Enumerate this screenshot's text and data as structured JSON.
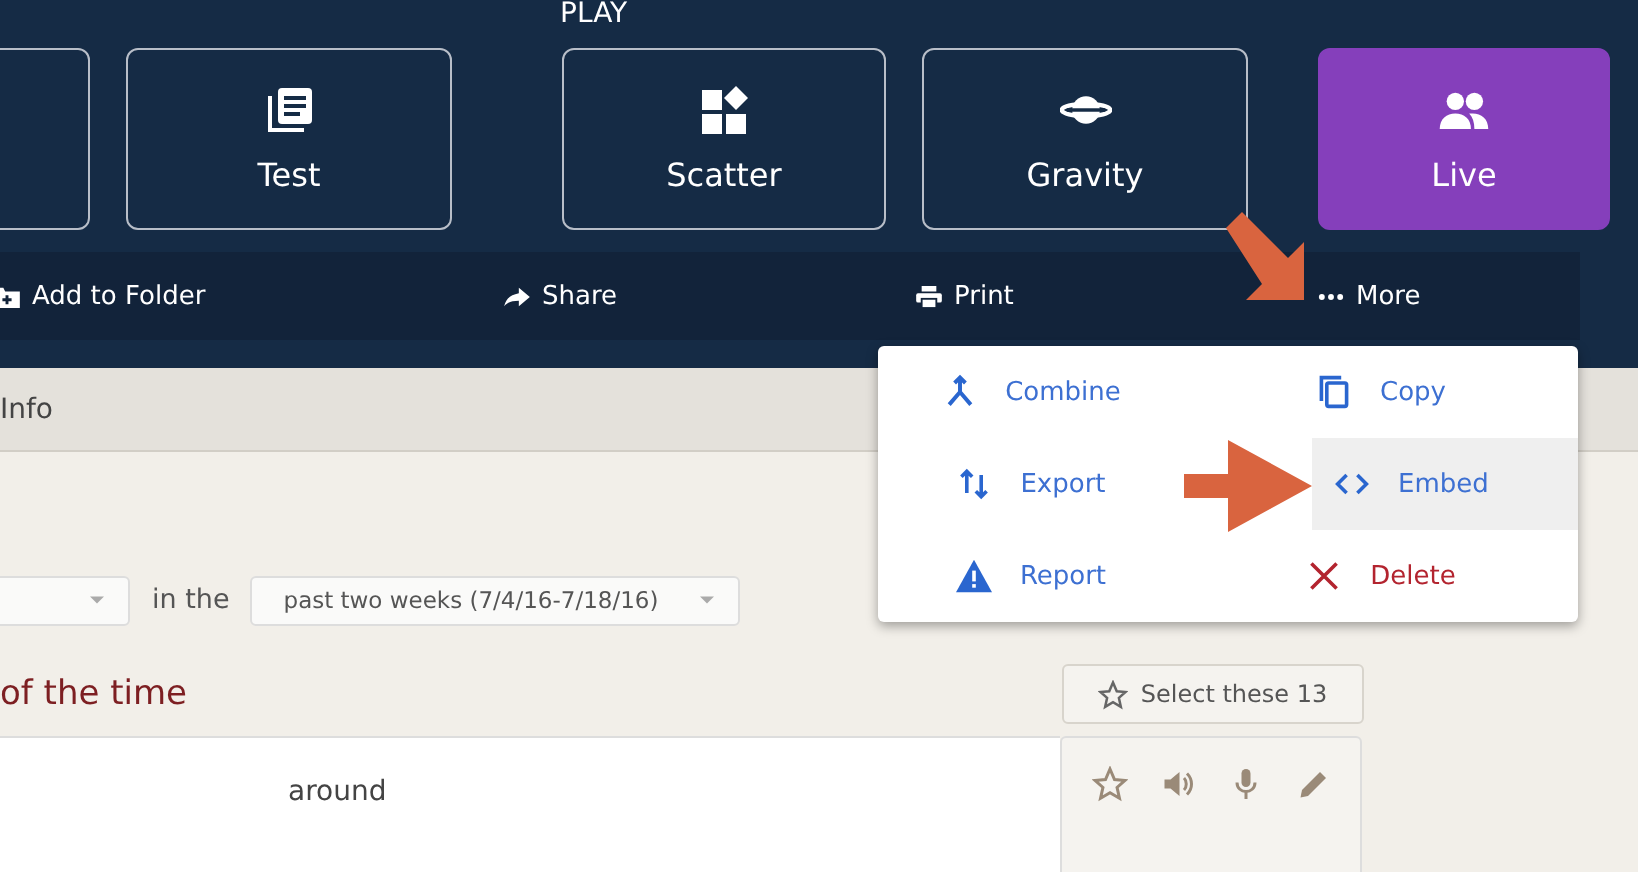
{
  "section_label": "PLAY",
  "modes": [
    {
      "label": "Test",
      "kind": "test",
      "selected": false
    },
    {
      "label": "Scatter",
      "kind": "scatter",
      "selected": false
    },
    {
      "label": "Gravity",
      "kind": "gravity",
      "selected": false
    },
    {
      "label": "Live",
      "kind": "live",
      "selected": true
    }
  ],
  "toolbar": [
    {
      "label": "Add to Folder",
      "kind": "folder"
    },
    {
      "label": "Share",
      "kind": "share"
    },
    {
      "label": "Print",
      "kind": "print"
    },
    {
      "label": "More",
      "kind": "more"
    }
  ],
  "tab_bar": {
    "label": "Info"
  },
  "filter": {
    "connector": "in the",
    "period": "past two weeks (7/4/16-7/18/16)"
  },
  "heading": "of the time",
  "select_button": "Select these 13",
  "term": "around",
  "menu": [
    {
      "label": "Combine",
      "kind": "combine",
      "selected": false
    },
    {
      "label": "Copy",
      "kind": "copy",
      "selected": false
    },
    {
      "label": "Export",
      "kind": "export",
      "selected": false
    },
    {
      "label": "Embed",
      "kind": "embed",
      "selected": true
    },
    {
      "label": "Report",
      "kind": "report",
      "selected": false
    },
    {
      "label": "Delete",
      "kind": "delete",
      "selected": false
    }
  ]
}
